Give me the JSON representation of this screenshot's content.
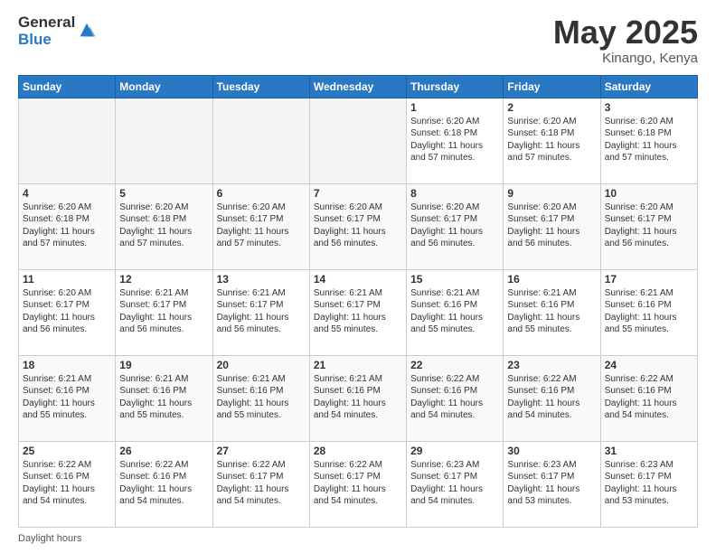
{
  "header": {
    "logo_general": "General",
    "logo_blue": "Blue",
    "title": "May 2025",
    "location": "Kinango, Kenya"
  },
  "footer": {
    "daylight_label": "Daylight hours"
  },
  "weekdays": [
    "Sunday",
    "Monday",
    "Tuesday",
    "Wednesday",
    "Thursday",
    "Friday",
    "Saturday"
  ],
  "weeks": [
    [
      {
        "day": "",
        "info": ""
      },
      {
        "day": "",
        "info": ""
      },
      {
        "day": "",
        "info": ""
      },
      {
        "day": "",
        "info": ""
      },
      {
        "day": "1",
        "info": "Sunrise: 6:20 AM\nSunset: 6:18 PM\nDaylight: 11 hours\nand 57 minutes."
      },
      {
        "day": "2",
        "info": "Sunrise: 6:20 AM\nSunset: 6:18 PM\nDaylight: 11 hours\nand 57 minutes."
      },
      {
        "day": "3",
        "info": "Sunrise: 6:20 AM\nSunset: 6:18 PM\nDaylight: 11 hours\nand 57 minutes."
      }
    ],
    [
      {
        "day": "4",
        "info": "Sunrise: 6:20 AM\nSunset: 6:18 PM\nDaylight: 11 hours\nand 57 minutes."
      },
      {
        "day": "5",
        "info": "Sunrise: 6:20 AM\nSunset: 6:18 PM\nDaylight: 11 hours\nand 57 minutes."
      },
      {
        "day": "6",
        "info": "Sunrise: 6:20 AM\nSunset: 6:17 PM\nDaylight: 11 hours\nand 57 minutes."
      },
      {
        "day": "7",
        "info": "Sunrise: 6:20 AM\nSunset: 6:17 PM\nDaylight: 11 hours\nand 56 minutes."
      },
      {
        "day": "8",
        "info": "Sunrise: 6:20 AM\nSunset: 6:17 PM\nDaylight: 11 hours\nand 56 minutes."
      },
      {
        "day": "9",
        "info": "Sunrise: 6:20 AM\nSunset: 6:17 PM\nDaylight: 11 hours\nand 56 minutes."
      },
      {
        "day": "10",
        "info": "Sunrise: 6:20 AM\nSunset: 6:17 PM\nDaylight: 11 hours\nand 56 minutes."
      }
    ],
    [
      {
        "day": "11",
        "info": "Sunrise: 6:20 AM\nSunset: 6:17 PM\nDaylight: 11 hours\nand 56 minutes."
      },
      {
        "day": "12",
        "info": "Sunrise: 6:21 AM\nSunset: 6:17 PM\nDaylight: 11 hours\nand 56 minutes."
      },
      {
        "day": "13",
        "info": "Sunrise: 6:21 AM\nSunset: 6:17 PM\nDaylight: 11 hours\nand 56 minutes."
      },
      {
        "day": "14",
        "info": "Sunrise: 6:21 AM\nSunset: 6:17 PM\nDaylight: 11 hours\nand 55 minutes."
      },
      {
        "day": "15",
        "info": "Sunrise: 6:21 AM\nSunset: 6:16 PM\nDaylight: 11 hours\nand 55 minutes."
      },
      {
        "day": "16",
        "info": "Sunrise: 6:21 AM\nSunset: 6:16 PM\nDaylight: 11 hours\nand 55 minutes."
      },
      {
        "day": "17",
        "info": "Sunrise: 6:21 AM\nSunset: 6:16 PM\nDaylight: 11 hours\nand 55 minutes."
      }
    ],
    [
      {
        "day": "18",
        "info": "Sunrise: 6:21 AM\nSunset: 6:16 PM\nDaylight: 11 hours\nand 55 minutes."
      },
      {
        "day": "19",
        "info": "Sunrise: 6:21 AM\nSunset: 6:16 PM\nDaylight: 11 hours\nand 55 minutes."
      },
      {
        "day": "20",
        "info": "Sunrise: 6:21 AM\nSunset: 6:16 PM\nDaylight: 11 hours\nand 55 minutes."
      },
      {
        "day": "21",
        "info": "Sunrise: 6:21 AM\nSunset: 6:16 PM\nDaylight: 11 hours\nand 54 minutes."
      },
      {
        "day": "22",
        "info": "Sunrise: 6:22 AM\nSunset: 6:16 PM\nDaylight: 11 hours\nand 54 minutes."
      },
      {
        "day": "23",
        "info": "Sunrise: 6:22 AM\nSunset: 6:16 PM\nDaylight: 11 hours\nand 54 minutes."
      },
      {
        "day": "24",
        "info": "Sunrise: 6:22 AM\nSunset: 6:16 PM\nDaylight: 11 hours\nand 54 minutes."
      }
    ],
    [
      {
        "day": "25",
        "info": "Sunrise: 6:22 AM\nSunset: 6:16 PM\nDaylight: 11 hours\nand 54 minutes."
      },
      {
        "day": "26",
        "info": "Sunrise: 6:22 AM\nSunset: 6:16 PM\nDaylight: 11 hours\nand 54 minutes."
      },
      {
        "day": "27",
        "info": "Sunrise: 6:22 AM\nSunset: 6:17 PM\nDaylight: 11 hours\nand 54 minutes."
      },
      {
        "day": "28",
        "info": "Sunrise: 6:22 AM\nSunset: 6:17 PM\nDaylight: 11 hours\nand 54 minutes."
      },
      {
        "day": "29",
        "info": "Sunrise: 6:23 AM\nSunset: 6:17 PM\nDaylight: 11 hours\nand 54 minutes."
      },
      {
        "day": "30",
        "info": "Sunrise: 6:23 AM\nSunset: 6:17 PM\nDaylight: 11 hours\nand 53 minutes."
      },
      {
        "day": "31",
        "info": "Sunrise: 6:23 AM\nSunset: 6:17 PM\nDaylight: 11 hours\nand 53 minutes."
      }
    ]
  ]
}
